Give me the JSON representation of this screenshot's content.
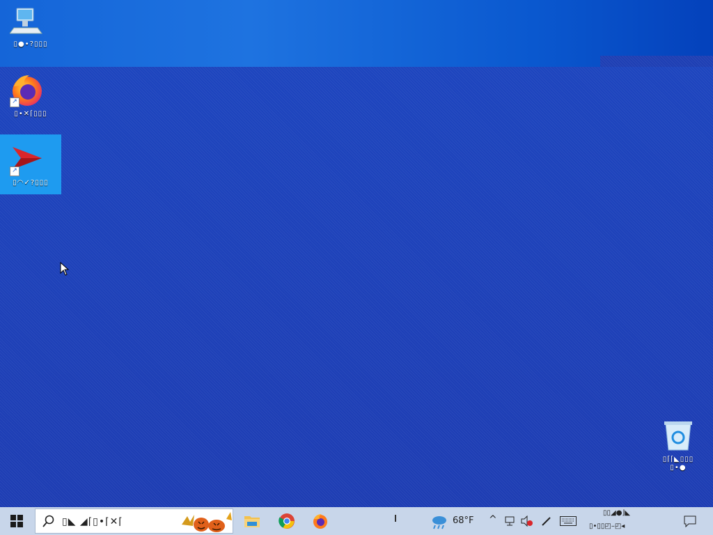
{
  "desktop": {
    "icons": [
      {
        "id": "this-pc",
        "label": "▯●•?▯▯▯"
      },
      {
        "id": "firefox",
        "label": "▯•✕⌈▯▯▯"
      },
      {
        "id": "app",
        "label": "▯◠✓?▯▯▯"
      }
    ],
    "recycle_bin": {
      "label_line1": "▯⌈⌈◣▯▯▯",
      "label_line2": "▯•●"
    }
  },
  "taskbar": {
    "search_text": "▯◣ ◢⌈▯•⌈✕⌈",
    "apps": [
      "file-explorer",
      "chrome",
      "firefox"
    ],
    "weather": {
      "temp": "68°F"
    },
    "clock": {
      "line1": "▯▯◢●⌋◣",
      "line2": "▯•▯▯◰–◰◂"
    },
    "colors": {
      "accent": "#1e9bf0",
      "taskbar": "#c8d6ea",
      "desktop": "#1e3fb4"
    }
  }
}
